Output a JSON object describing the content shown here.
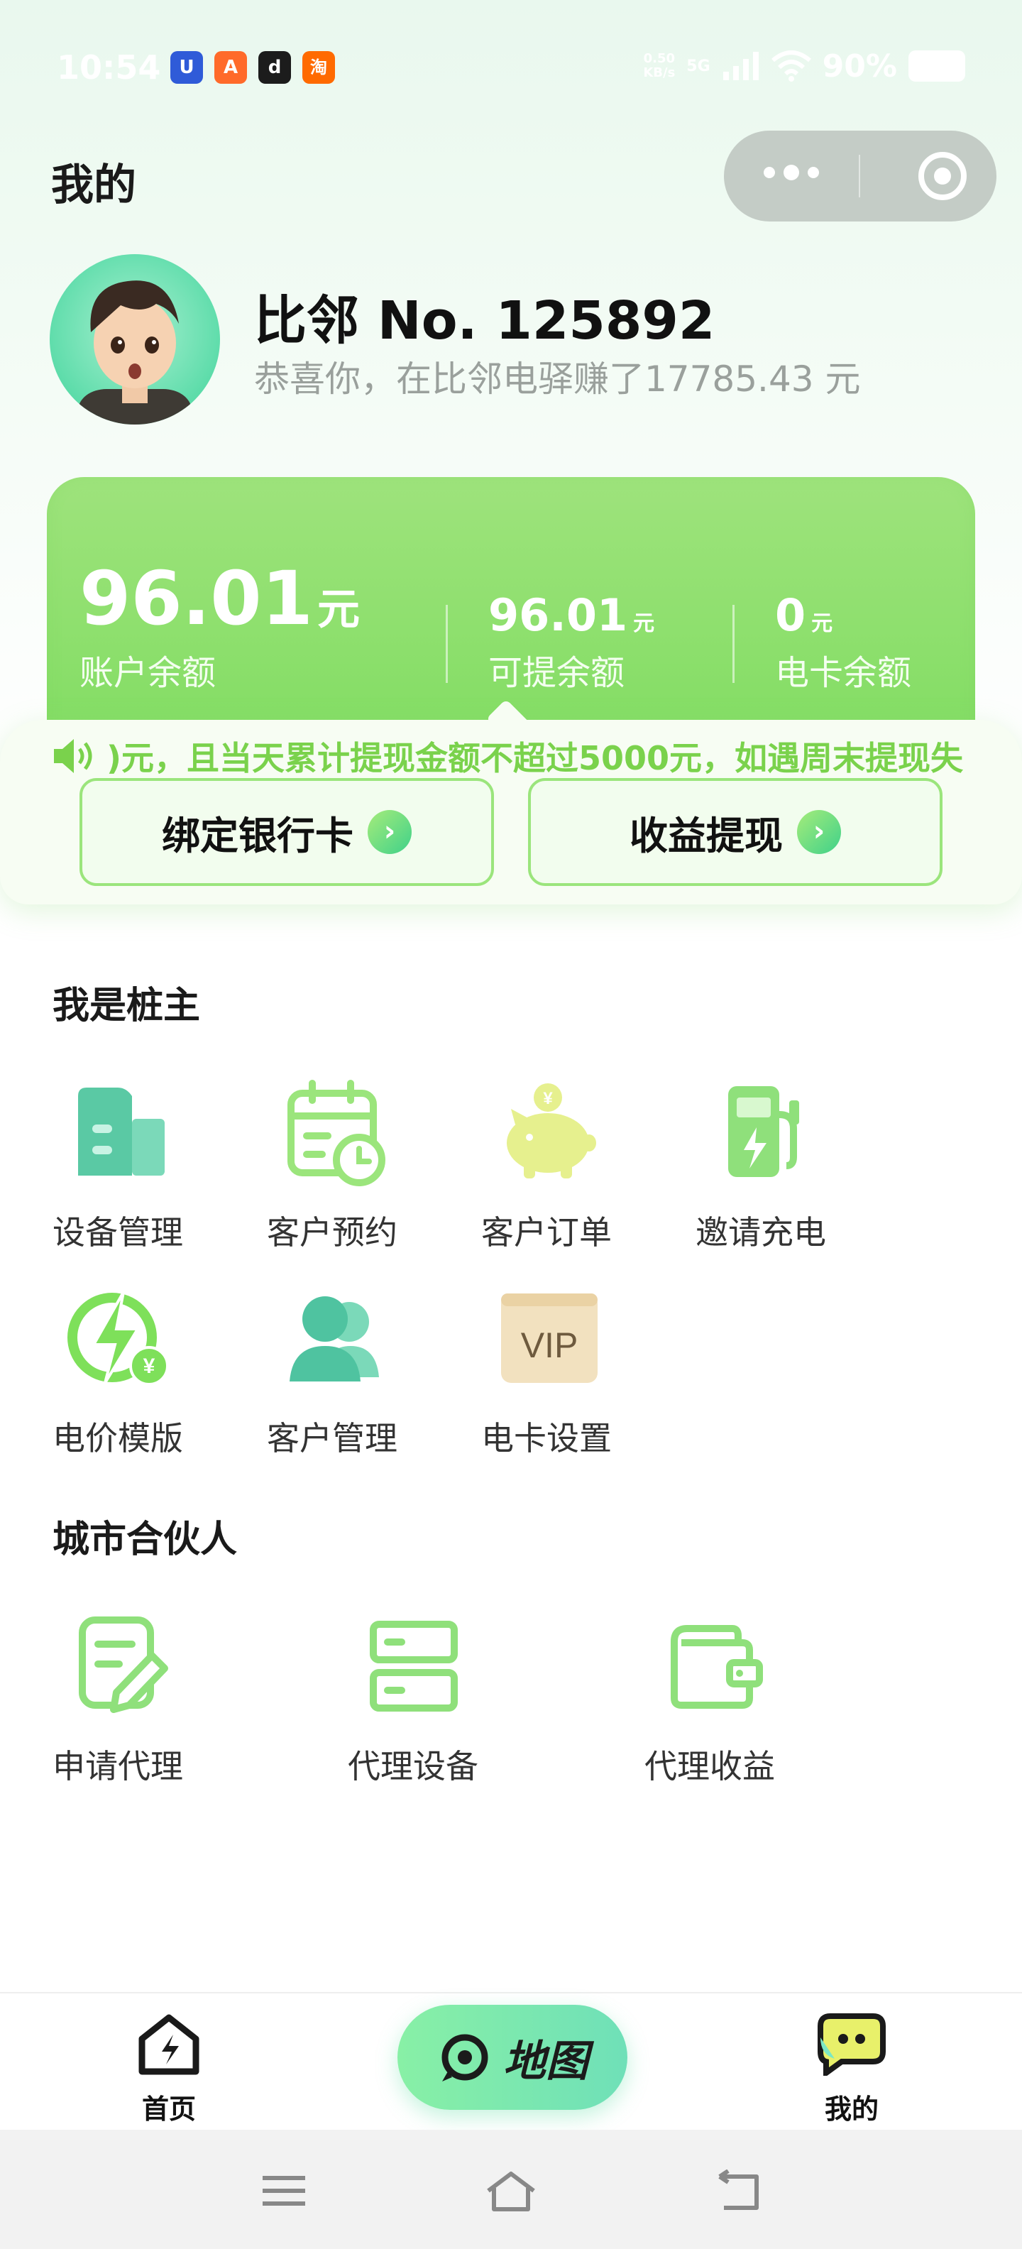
{
  "status_bar": {
    "time": "10:54",
    "apps": [
      {
        "name": "app-shield",
        "glyph": "U",
        "color": "#2f5bd8"
      },
      {
        "name": "app-orange",
        "glyph": "A",
        "color": "#ff6a2a"
      },
      {
        "name": "app-tiktok",
        "glyph": "d",
        "color": "#1c1c1c"
      },
      {
        "name": "app-taobao",
        "glyph": "淘",
        "color": "#ff6a00"
      }
    ],
    "net_speed": "0.50",
    "net_unit": "KB/s",
    "network": "5G",
    "battery": "90%"
  },
  "header": {
    "title": "我的",
    "capsule_more_icon": "more-dots-icon",
    "capsule_close_icon": "target-icon"
  },
  "profile": {
    "username": "比邻 No. 125892",
    "earn_text": "恭喜你，在比邻电驿赚了17785.43 元"
  },
  "balance": {
    "main": {
      "value": "96.01",
      "unit": "元",
      "label": "账户余额"
    },
    "withdrawable": {
      "value": "96.01",
      "unit": "元",
      "label": "可提余额"
    },
    "card": {
      "value": "0",
      "unit": "元",
      "label": "电卡余额"
    }
  },
  "notice": {
    "icon": "speaker-icon",
    "text": ")元，且当天累计提现金额不超过5000元，如遇周末提现失"
  },
  "actions": {
    "bind_card": "绑定银行卡",
    "withdraw": "收益提现"
  },
  "owner_section": {
    "title": "我是桩主",
    "items": [
      {
        "label": "设备管理",
        "icon": "building-icon"
      },
      {
        "label": "客户预约",
        "icon": "calendar-clock-icon"
      },
      {
        "label": "客户订单",
        "icon": "piggy-bank-icon"
      },
      {
        "label": "邀请充电",
        "icon": "charging-pump-icon"
      },
      {
        "label": "电价模版",
        "icon": "lightning-price-icon"
      },
      {
        "label": "客户管理",
        "icon": "users-icon"
      },
      {
        "label": "电卡设置",
        "icon": "vip-card-icon"
      }
    ]
  },
  "partner_section": {
    "title": "城市合伙人",
    "items": [
      {
        "label": "申请代理",
        "icon": "edit-document-icon"
      },
      {
        "label": "代理设备",
        "icon": "server-icon"
      },
      {
        "label": "代理收益",
        "icon": "wallet-icon"
      }
    ]
  },
  "bottom_nav": {
    "home": "首页",
    "map": "地图",
    "mine": "我的"
  },
  "colors": {
    "accent": "#82dd63",
    "accent_light": "#9ee37c",
    "teal": "#5ac9a4",
    "notice_text": "#7ad24c"
  }
}
